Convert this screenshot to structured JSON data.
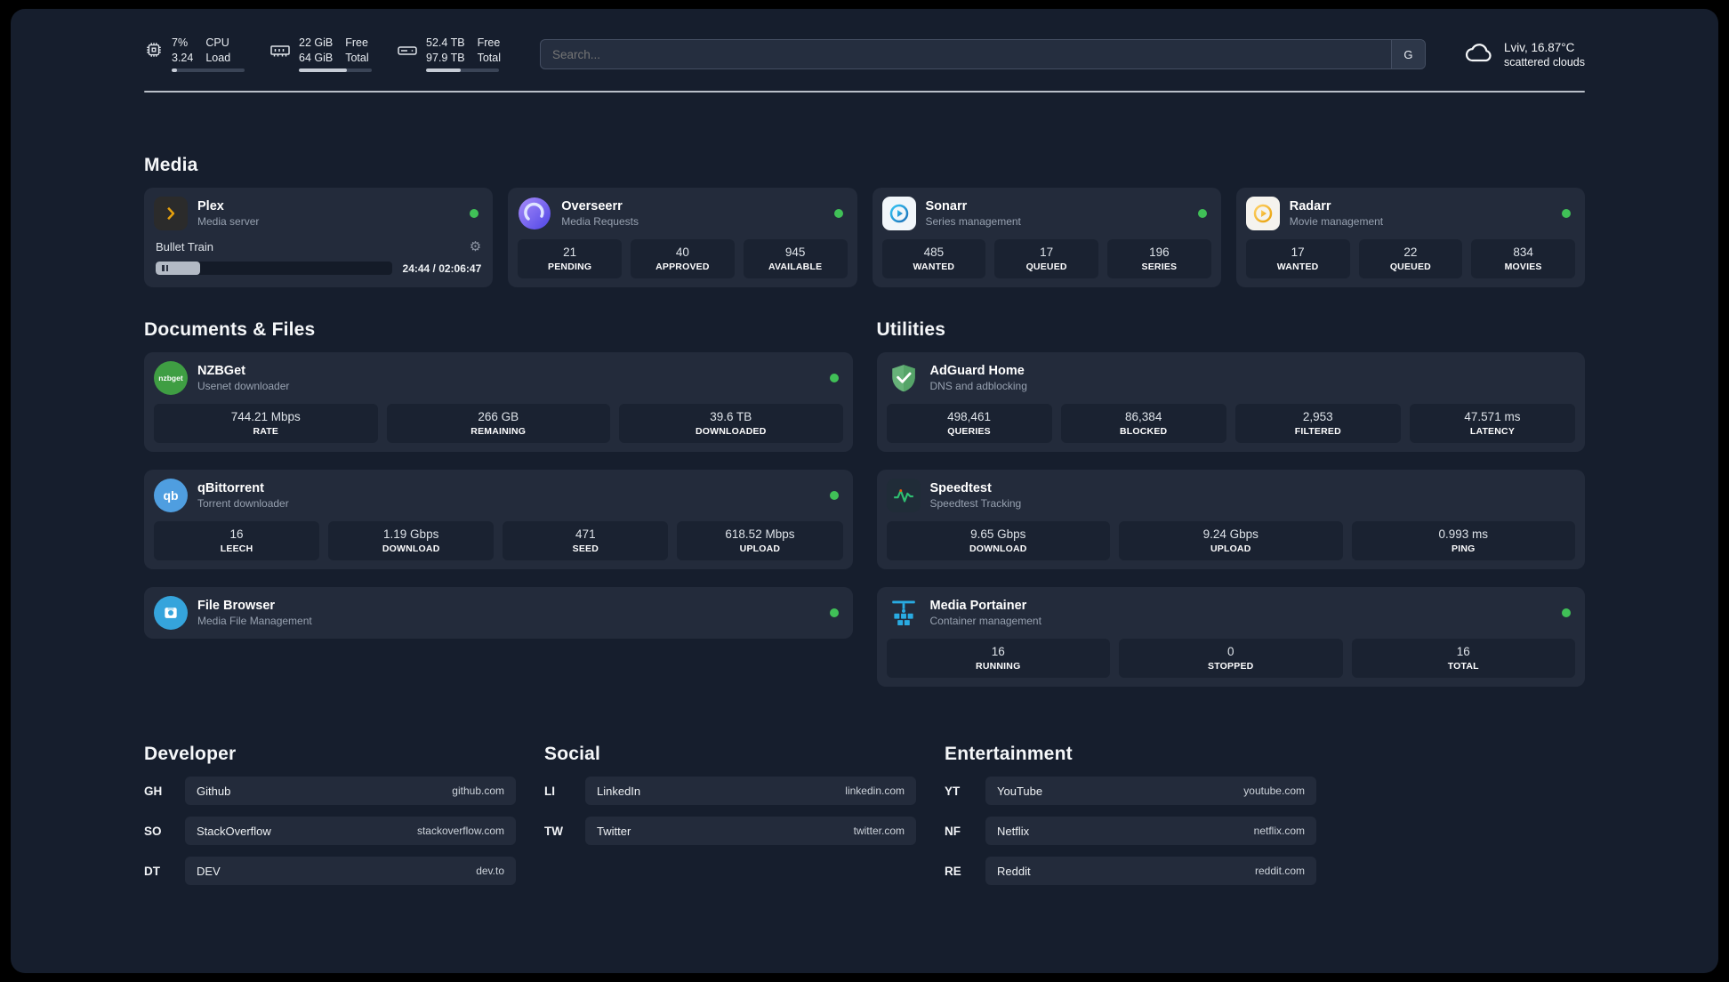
{
  "topbar": {
    "cpu": {
      "value_top": "7%",
      "value_bottom": "3.24",
      "label_top": "CPU",
      "label_bottom": "Load"
    },
    "ram": {
      "value_top": "22 GiB",
      "value_bottom": "64 GiB",
      "label_top": "Free",
      "label_bottom": "Total"
    },
    "disk": {
      "value_top": "52.4 TB",
      "value_bottom": "97.9 TB",
      "label_top": "Free",
      "label_bottom": "Total"
    },
    "search": {
      "placeholder": "Search...",
      "engine_label": "G"
    },
    "weather": {
      "location": "Lviv, 16.87°C",
      "condition": "scattered clouds"
    }
  },
  "sections": {
    "media": "Media",
    "documents": "Documents & Files",
    "utilities": "Utilities",
    "developer": "Developer",
    "social": "Social",
    "entertainment": "Entertainment"
  },
  "apps": {
    "plex": {
      "name": "Plex",
      "subtitle": "Media server",
      "now_playing": "Bullet Train",
      "time": "24:44 / 02:06:47"
    },
    "overseerr": {
      "name": "Overseerr",
      "subtitle": "Media Requests",
      "stats": [
        {
          "value": "21",
          "label": "PENDING"
        },
        {
          "value": "40",
          "label": "APPROVED"
        },
        {
          "value": "945",
          "label": "AVAILABLE"
        }
      ]
    },
    "sonarr": {
      "name": "Sonarr",
      "subtitle": "Series management",
      "stats": [
        {
          "value": "485",
          "label": "WANTED"
        },
        {
          "value": "17",
          "label": "QUEUED"
        },
        {
          "value": "196",
          "label": "SERIES"
        }
      ]
    },
    "radarr": {
      "name": "Radarr",
      "subtitle": "Movie management",
      "stats": [
        {
          "value": "17",
          "label": "WANTED"
        },
        {
          "value": "22",
          "label": "QUEUED"
        },
        {
          "value": "834",
          "label": "MOVIES"
        }
      ]
    },
    "nzbget": {
      "name": "NZBGet",
      "subtitle": "Usenet downloader",
      "icon_text": "nzbget",
      "stats": [
        {
          "value": "744.21 Mbps",
          "label": "RATE"
        },
        {
          "value": "266 GB",
          "label": "REMAINING"
        },
        {
          "value": "39.6 TB",
          "label": "DOWNLOADED"
        }
      ]
    },
    "qbittorrent": {
      "name": "qBittorrent",
      "subtitle": "Torrent downloader",
      "icon_text": "qb",
      "stats": [
        {
          "value": "16",
          "label": "LEECH"
        },
        {
          "value": "1.19 Gbps",
          "label": "DOWNLOAD"
        },
        {
          "value": "471",
          "label": "SEED"
        },
        {
          "value": "618.52 Mbps",
          "label": "UPLOAD"
        }
      ]
    },
    "filebrowser": {
      "name": "File Browser",
      "subtitle": "Media File Management"
    },
    "adguard": {
      "name": "AdGuard Home",
      "subtitle": "DNS and adblocking",
      "stats": [
        {
          "value": "498,461",
          "label": "QUERIES"
        },
        {
          "value": "86,384",
          "label": "BLOCKED"
        },
        {
          "value": "2,953",
          "label": "FILTERED"
        },
        {
          "value": "47.571 ms",
          "label": "LATENCY"
        }
      ]
    },
    "speedtest": {
      "name": "Speedtest",
      "subtitle": "Speedtest Tracking",
      "stats": [
        {
          "value": "9.65 Gbps",
          "label": "DOWNLOAD"
        },
        {
          "value": "9.24 Gbps",
          "label": "UPLOAD"
        },
        {
          "value": "0.993 ms",
          "label": "PING"
        }
      ]
    },
    "portainer": {
      "name": "Media Portainer",
      "subtitle": "Container management",
      "stats": [
        {
          "value": "16",
          "label": "RUNNING"
        },
        {
          "value": "0",
          "label": "STOPPED"
        },
        {
          "value": "16",
          "label": "TOTAL"
        }
      ]
    }
  },
  "bookmarks": {
    "developer": [
      {
        "abbr": "GH",
        "name": "Github",
        "url": "github.com"
      },
      {
        "abbr": "SO",
        "name": "StackOverflow",
        "url": "stackoverflow.com"
      },
      {
        "abbr": "DT",
        "name": "DEV",
        "url": "dev.to"
      }
    ],
    "social": [
      {
        "abbr": "LI",
        "name": "LinkedIn",
        "url": "linkedin.com"
      },
      {
        "abbr": "TW",
        "name": "Twitter",
        "url": "twitter.com"
      }
    ],
    "entertainment": [
      {
        "abbr": "YT",
        "name": "YouTube",
        "url": "youtube.com"
      },
      {
        "abbr": "NF",
        "name": "Netflix",
        "url": "netflix.com"
      },
      {
        "abbr": "RE",
        "name": "Reddit",
        "url": "reddit.com"
      }
    ]
  },
  "colors": {
    "status_green": "#40c057",
    "accent_amber": "#e5a00d"
  }
}
